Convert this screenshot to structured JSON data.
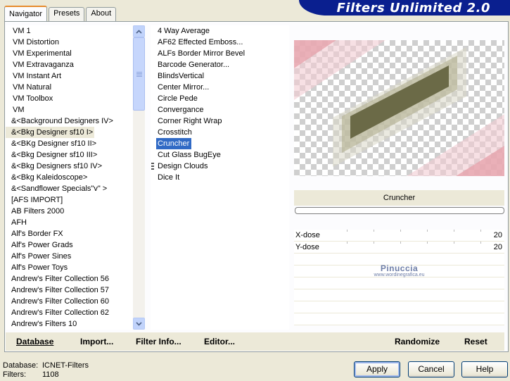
{
  "header": {
    "title": "Filters Unlimited 2.0"
  },
  "tabs": [
    {
      "label": "Navigator",
      "active": true
    },
    {
      "label": "Presets",
      "active": false
    },
    {
      "label": "About",
      "active": false
    }
  ],
  "categories": [
    "VM 1",
    "VM Distortion",
    "VM Experimental",
    "VM Extravaganza",
    "VM Instant Art",
    "VM Natural",
    "VM Toolbox",
    "VM",
    "&<Background Designers IV>",
    "&<Bkg Designer sf10 I>",
    "&<BKg Designer sf10 II>",
    "&<Bkg Designer sf10 III>",
    "&<Bkg Designers sf10 IV>",
    "&<Bkg Kaleidoscope>",
    "&<Sandflower Specials\"v\" >",
    "[AFS IMPORT]",
    "AB Filters 2000",
    "AFH",
    "Alf's Border FX",
    "Alf's Power Grads",
    "Alf's Power Sines",
    "Alf's Power Toys",
    "Andrew's Filter Collection 56",
    "Andrew's Filter Collection 57",
    "Andrew's Filter Collection 60",
    "Andrew's Filter Collection 62",
    "Andrew's Filters 10"
  ],
  "selected_category": "&<Bkg Designer sf10 I>",
  "filters": [
    "4 Way Average",
    "AF62 Effected Emboss...",
    "ALFs Border Mirror Bevel",
    "Barcode Generator...",
    "BlindsVertical",
    "Center Mirror...",
    "Circle Pede",
    "Convergance",
    "Corner Right Wrap",
    "Crosstitch",
    "Cruncher",
    "Cut Glass  BugEye",
    "Design Clouds",
    "Dice It"
  ],
  "selected_filter": "Cruncher",
  "preview": {
    "filter_name": "Cruncher"
  },
  "params": [
    {
      "label": "X-dose",
      "value": "20"
    },
    {
      "label": "Y-dose",
      "value": "20"
    }
  ],
  "watermark": {
    "name": "Pinuccia",
    "url": "www.wordinegrafica.eu"
  },
  "bottom_buttons": {
    "database": "Database",
    "import": "Import...",
    "filter_info": "Filter Info...",
    "editor": "Editor...",
    "randomize": "Randomize",
    "reset": "Reset"
  },
  "status": {
    "database_label": "Database:",
    "database_value": "ICNET-Filters",
    "filters_label": "Filters:",
    "filters_value": "1108"
  },
  "dialog_buttons": {
    "apply": "Apply",
    "cancel": "Cancel",
    "help": "Help"
  },
  "colors": {
    "selection": "#316ac5",
    "header": "#0a1f8f",
    "preview_pink": "#e8a7b0",
    "preview_olive": "#6b6a47"
  }
}
